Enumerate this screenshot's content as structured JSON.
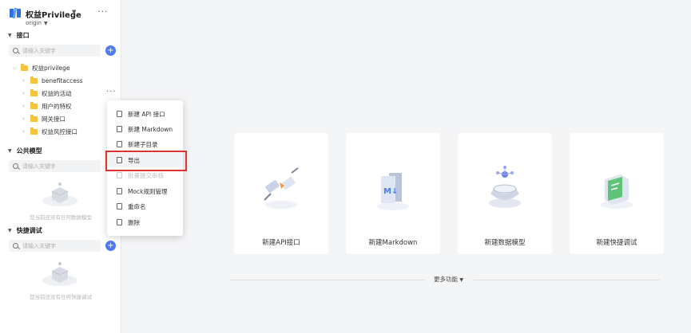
{
  "project": {
    "name": "权益Privilege",
    "branch": "origin"
  },
  "sections": {
    "api": {
      "title": "接口",
      "search_placeholder": "请输入关键字"
    },
    "models": {
      "title": "公共模型",
      "search_placeholder": "请输入关键字",
      "empty_text": "您当前还没有任何数据模型"
    },
    "debug": {
      "title": "快捷调试",
      "search_placeholder": "请输入关键字",
      "empty_text": "您当前还没有任何快捷调试"
    }
  },
  "tree": {
    "root": "权益privilege",
    "children": [
      "benefitaccess",
      "权益的活动",
      "用户的特权",
      "网关接口",
      "权益风控接口"
    ]
  },
  "context_menu": {
    "items": [
      "新建 API 接口",
      "新建 Markdown",
      "新建子目录",
      "导出",
      "批量提交审核",
      "Mock规则管理",
      "重命名",
      "删除"
    ]
  },
  "cards": [
    "新建API接口",
    "新建Markdown",
    "新建数据模型",
    "新建快捷调试"
  ],
  "more_features": "更多功能",
  "colors": {
    "accent": "#4e7bf3",
    "folder": "#f5c23b",
    "highlight": "#e03030"
  }
}
